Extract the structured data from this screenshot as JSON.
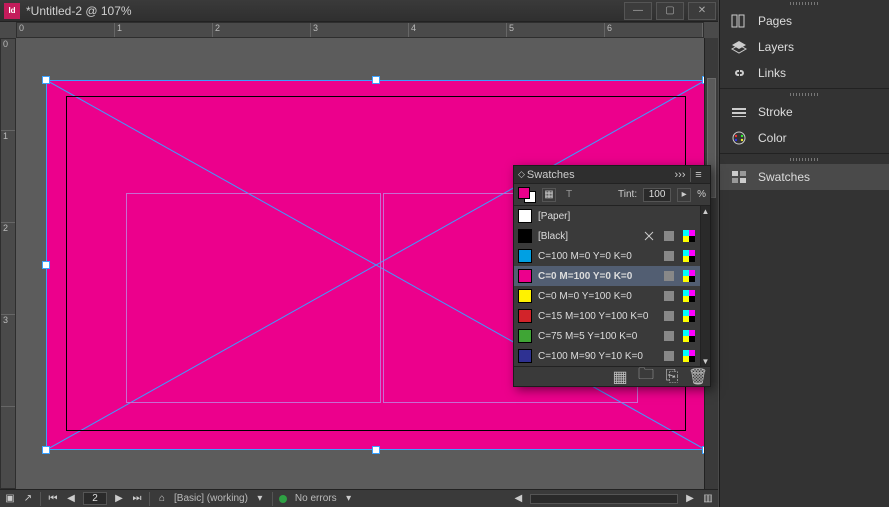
{
  "window": {
    "title": "*Untitled-2 @ 107%",
    "app_abbrev": "Id"
  },
  "ruler_h": [
    "0",
    "1",
    "2",
    "3",
    "4",
    "5",
    "6"
  ],
  "ruler_v": [
    "0",
    "1",
    "2",
    "3"
  ],
  "status": {
    "page": "2",
    "preset": "[Basic] (working)",
    "errors": "No errors"
  },
  "right_panels": {
    "group1": [
      {
        "icon": "pages",
        "label": "Pages"
      },
      {
        "icon": "layers",
        "label": "Layers"
      },
      {
        "icon": "links",
        "label": "Links"
      }
    ],
    "group2": [
      {
        "icon": "stroke",
        "label": "Stroke"
      },
      {
        "icon": "color",
        "label": "Color"
      }
    ],
    "group3": [
      {
        "icon": "swatches",
        "label": "Swatches",
        "selected": true
      }
    ]
  },
  "swatches_panel": {
    "title": "Swatches",
    "tint_label": "Tint:",
    "tint_value": "100",
    "tint_unit": "%",
    "swatches": [
      {
        "name": "[Paper]",
        "color": "#ffffff",
        "locked": false,
        "cmyk": false
      },
      {
        "name": "[Black]",
        "color": "#000000",
        "locked": true,
        "cmyk": true
      },
      {
        "name": "C=100 M=0 Y=0 K=0",
        "color": "#00a0e3",
        "locked": false,
        "cmyk": true
      },
      {
        "name": "C=0 M=100 Y=0 K=0",
        "color": "#ec008c",
        "locked": false,
        "cmyk": true,
        "selected": true
      },
      {
        "name": "C=0 M=0 Y=100 K=0",
        "color": "#fff200",
        "locked": false,
        "cmyk": true
      },
      {
        "name": "C=15 M=100 Y=100 K=0",
        "color": "#d2232a",
        "locked": false,
        "cmyk": true
      },
      {
        "name": "C=75 M=5 Y=100 K=0",
        "color": "#3fa535",
        "locked": false,
        "cmyk": true
      },
      {
        "name": "C=100 M=90 Y=10 K=0",
        "color": "#2e3192",
        "locked": false,
        "cmyk": true
      }
    ]
  }
}
